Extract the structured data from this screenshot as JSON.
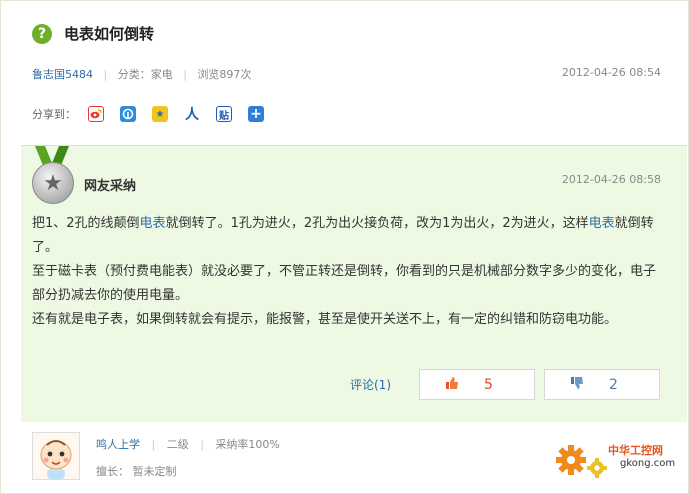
{
  "question": {
    "badge": "?",
    "title": "电表如何倒转",
    "author": "鲁志国5484",
    "category": "分类：家电",
    "views": "浏览897次",
    "date": "2012-04-26 08:54"
  },
  "share": {
    "label": "分享到：",
    "icons": [
      "weibo-icon",
      "qzone-icon",
      "star-icon",
      "renren-icon",
      "tieba-icon",
      "plus-icon"
    ]
  },
  "answer": {
    "title": "网友采纳",
    "date": "2012-04-26 08:58",
    "para1_a": "把1、2孔的线颠倒",
    "para1_kw1": "电表",
    "para1_b": "就倒转了。1孔为进火，2孔为出火接负荷，改为1为出火，2为进火，这样",
    "para1_kw2": "电表",
    "para1_c": "就倒转了。",
    "para2": "至于磁卡表（预付费电能表）就没必要了，不管正转还是倒转，你看到的只是机械部分数字多少的变化，电子部分扔减去你的使用电量。",
    "para3": "还有就是电子表，如果倒转就会有提示，能报警，甚至是使开关送不上，有一定的纠错和防窃电功能。",
    "comment_label": "评论(1)",
    "upvotes": "5",
    "downvotes": "2"
  },
  "answerer": {
    "name": "鸣人上学",
    "level": "二级",
    "accept_rate": "采纳率100%",
    "specialty": "擅长： 暂未定制"
  },
  "watermark": {
    "name": "中华工控网",
    "url": "gkong.com"
  },
  "colors": {
    "accent_green": "#6fb02b",
    "answer_bg": "#eef9e3",
    "link_blue": "#2e6da4",
    "upvote_red": "#e0452a"
  }
}
